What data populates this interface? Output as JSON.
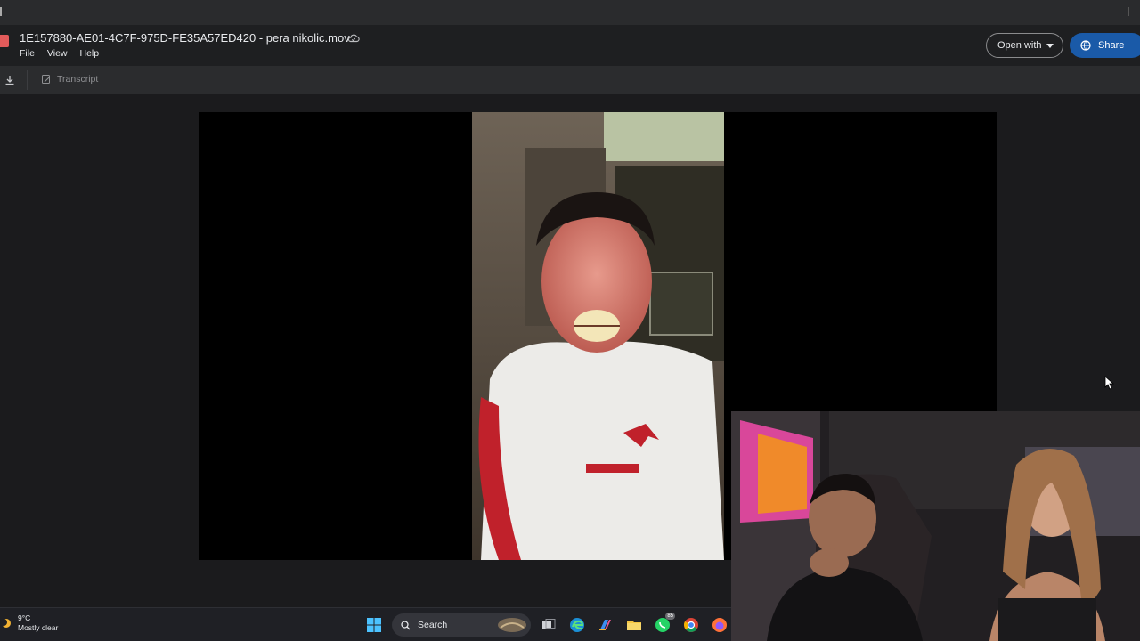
{
  "window": {
    "file_title": "1E157880-AE01-4C7F-975D-FE35A57ED420 - pera nikolic.mov",
    "menu": [
      "File",
      "View",
      "Help"
    ],
    "open_with_label": "Open with",
    "share_label": "Share"
  },
  "toolbar": {
    "transcript_label": "Transcript"
  },
  "taskbar": {
    "weather_temp": "9°C",
    "weather_desc": "Mostly clear",
    "search_label": "Search",
    "whatsapp_badge": "85"
  },
  "colors": {
    "share_button": "#1a5aa8",
    "player_background": "#000000",
    "viewer_background": "#1b1b1d"
  },
  "icons": [
    "file-video-icon",
    "cloud-saved-icon",
    "download-icon",
    "transcript-icon",
    "globe-icon",
    "windows-start-icon",
    "search-icon",
    "task-view-icon",
    "edge-icon",
    "copilot-icon",
    "file-explorer-icon",
    "whatsapp-icon",
    "chrome-icon",
    "firefox-icon"
  ]
}
